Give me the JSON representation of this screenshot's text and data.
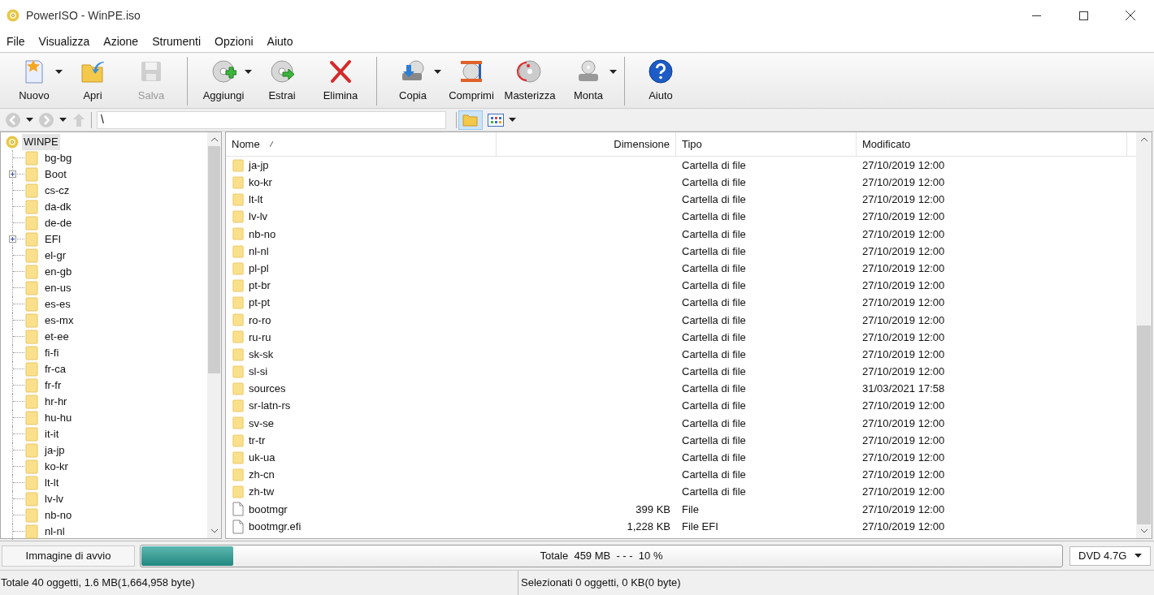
{
  "window": {
    "title": "PowerISO - WinPE.iso"
  },
  "menu": [
    "File",
    "Visualizza",
    "Azione",
    "Strumenti",
    "Opzioni",
    "Aiuto"
  ],
  "toolbar": [
    {
      "kind": "button",
      "label": "Nuovo",
      "disabled": false,
      "dropdown": true
    },
    {
      "kind": "button",
      "label": "Apri",
      "disabled": false,
      "dropdown": false
    },
    {
      "kind": "button",
      "label": "Salva",
      "disabled": true,
      "dropdown": false
    },
    {
      "kind": "separator"
    },
    {
      "kind": "button",
      "label": "Aggiungi",
      "disabled": false,
      "dropdown": true
    },
    {
      "kind": "button",
      "label": "Estrai",
      "disabled": false,
      "dropdown": false
    },
    {
      "kind": "button",
      "label": "Elimina",
      "disabled": false,
      "dropdown": false
    },
    {
      "kind": "separator"
    },
    {
      "kind": "button",
      "label": "Copia",
      "disabled": false,
      "dropdown": true
    },
    {
      "kind": "button",
      "label": "Comprimi",
      "disabled": false,
      "dropdown": false
    },
    {
      "kind": "button",
      "label": "Masterizza",
      "disabled": false,
      "dropdown": false
    },
    {
      "kind": "button",
      "label": "Monta",
      "disabled": false,
      "dropdown": true
    },
    {
      "kind": "separator"
    },
    {
      "kind": "button",
      "label": "Aiuto",
      "disabled": false,
      "dropdown": false
    }
  ],
  "address_bar": {
    "path": "\\",
    "folder_view_selected": true
  },
  "tree": {
    "root": {
      "label": "WINPE",
      "selected": true
    },
    "items": [
      {
        "label": "bg-bg",
        "expandable": false
      },
      {
        "label": "Boot",
        "expandable": true
      },
      {
        "label": "cs-cz",
        "expandable": false
      },
      {
        "label": "da-dk",
        "expandable": false
      },
      {
        "label": "de-de",
        "expandable": false
      },
      {
        "label": "EFI",
        "expandable": true
      },
      {
        "label": "el-gr",
        "expandable": false
      },
      {
        "label": "en-gb",
        "expandable": false
      },
      {
        "label": "en-us",
        "expandable": false
      },
      {
        "label": "es-es",
        "expandable": false
      },
      {
        "label": "es-mx",
        "expandable": false
      },
      {
        "label": "et-ee",
        "expandable": false
      },
      {
        "label": "fi-fi",
        "expandable": false
      },
      {
        "label": "fr-ca",
        "expandable": false
      },
      {
        "label": "fr-fr",
        "expandable": false
      },
      {
        "label": "hr-hr",
        "expandable": false
      },
      {
        "label": "hu-hu",
        "expandable": false
      },
      {
        "label": "it-it",
        "expandable": false
      },
      {
        "label": "ja-jp",
        "expandable": false
      },
      {
        "label": "ko-kr",
        "expandable": false
      },
      {
        "label": "lt-lt",
        "expandable": false
      },
      {
        "label": "lv-lv",
        "expandable": false
      },
      {
        "label": "nb-no",
        "expandable": false
      },
      {
        "label": "nl-nl",
        "expandable": false
      }
    ]
  },
  "table": {
    "columns": [
      "Nome",
      "Dimensione",
      "Tipo",
      "Modificato"
    ],
    "rows": [
      {
        "kind": "folder",
        "name": "ja-jp",
        "size": "",
        "type": "Cartella di file",
        "modified": "27/10/2019 12:00"
      },
      {
        "kind": "folder",
        "name": "ko-kr",
        "size": "",
        "type": "Cartella di file",
        "modified": "27/10/2019 12:00"
      },
      {
        "kind": "folder",
        "name": "lt-lt",
        "size": "",
        "type": "Cartella di file",
        "modified": "27/10/2019 12:00"
      },
      {
        "kind": "folder",
        "name": "lv-lv",
        "size": "",
        "type": "Cartella di file",
        "modified": "27/10/2019 12:00"
      },
      {
        "kind": "folder",
        "name": "nb-no",
        "size": "",
        "type": "Cartella di file",
        "modified": "27/10/2019 12:00"
      },
      {
        "kind": "folder",
        "name": "nl-nl",
        "size": "",
        "type": "Cartella di file",
        "modified": "27/10/2019 12:00"
      },
      {
        "kind": "folder",
        "name": "pl-pl",
        "size": "",
        "type": "Cartella di file",
        "modified": "27/10/2019 12:00"
      },
      {
        "kind": "folder",
        "name": "pt-br",
        "size": "",
        "type": "Cartella di file",
        "modified": "27/10/2019 12:00"
      },
      {
        "kind": "folder",
        "name": "pt-pt",
        "size": "",
        "type": "Cartella di file",
        "modified": "27/10/2019 12:00"
      },
      {
        "kind": "folder",
        "name": "ro-ro",
        "size": "",
        "type": "Cartella di file",
        "modified": "27/10/2019 12:00"
      },
      {
        "kind": "folder",
        "name": "ru-ru",
        "size": "",
        "type": "Cartella di file",
        "modified": "27/10/2019 12:00"
      },
      {
        "kind": "folder",
        "name": "sk-sk",
        "size": "",
        "type": "Cartella di file",
        "modified": "27/10/2019 12:00"
      },
      {
        "kind": "folder",
        "name": "sl-si",
        "size": "",
        "type": "Cartella di file",
        "modified": "27/10/2019 12:00"
      },
      {
        "kind": "folder",
        "name": "sources",
        "size": "",
        "type": "Cartella di file",
        "modified": "31/03/2021 17:58"
      },
      {
        "kind": "folder",
        "name": "sr-latn-rs",
        "size": "",
        "type": "Cartella di file",
        "modified": "27/10/2019 12:00"
      },
      {
        "kind": "folder",
        "name": "sv-se",
        "size": "",
        "type": "Cartella di file",
        "modified": "27/10/2019 12:00"
      },
      {
        "kind": "folder",
        "name": "tr-tr",
        "size": "",
        "type": "Cartella di file",
        "modified": "27/10/2019 12:00"
      },
      {
        "kind": "folder",
        "name": "uk-ua",
        "size": "",
        "type": "Cartella di file",
        "modified": "27/10/2019 12:00"
      },
      {
        "kind": "folder",
        "name": "zh-cn",
        "size": "",
        "type": "Cartella di file",
        "modified": "27/10/2019 12:00"
      },
      {
        "kind": "folder",
        "name": "zh-tw",
        "size": "",
        "type": "Cartella di file",
        "modified": "27/10/2019 12:00"
      },
      {
        "kind": "file",
        "name": "bootmgr",
        "size": "399 KB",
        "type": "File",
        "modified": "27/10/2019 12:00"
      },
      {
        "kind": "file",
        "name": "bootmgr.efi",
        "size": "1,228 KB",
        "type": "File EFI",
        "modified": "27/10/2019 12:00"
      }
    ]
  },
  "capacity_bar": {
    "label": "Immagine di avvio",
    "level": 0.1,
    "total_label": "Totale",
    "total_size": "459 MB",
    "separator": "- - -",
    "percent": "10 %",
    "media": "DVD 4.7G"
  },
  "status_bar": [
    "Totale 40 oggetti, 1.6 MB(1,664,958 byte)",
    "Selezionati 0 oggetti, 0 KB(0 byte)"
  ]
}
